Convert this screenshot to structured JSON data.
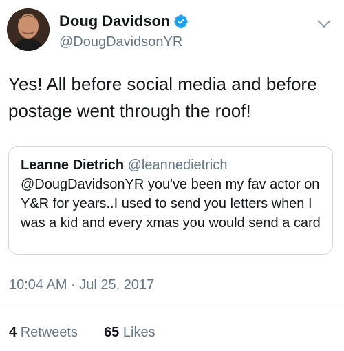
{
  "author": {
    "display_name": "Doug Davidson",
    "handle": "@DougDavidsonYR",
    "verified": true
  },
  "tweet": {
    "text": "Yes! All before social media and before postage went through the roof!",
    "timestamp": "10:04 AM · Jul 25, 2017"
  },
  "quoted_tweet": {
    "display_name": "Leanne Dietrich",
    "handle": "@leannedietrich",
    "text": "@DougDavidsonYR you've been my fav actor on Y&R for years..I used to send you letters when I was a kid and every xmas you would send a card"
  },
  "stats": {
    "retweets_count": "4",
    "retweets_label": "Retweets",
    "likes_count": "65",
    "likes_label": "Likes"
  },
  "icons": {
    "verified": "verified-badge-icon",
    "menu": "chevron-down-icon"
  },
  "colors": {
    "verified_blue": "#1da1f2",
    "secondary_text": "#657786",
    "border": "#ccd6dd"
  }
}
